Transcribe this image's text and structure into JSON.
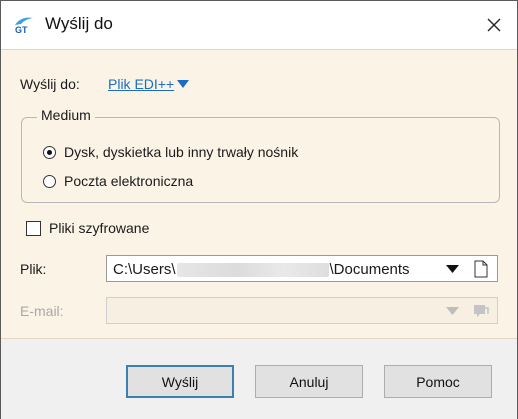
{
  "window": {
    "title": "Wyślij do",
    "app_icon": "gt-logo-icon",
    "close_icon": "close-icon"
  },
  "send_to": {
    "label": "Wyślij do:",
    "value": "Plik EDI++",
    "dropdown_icon": "caret-down-icon"
  },
  "medium": {
    "legend": "Medium",
    "options": [
      {
        "label": "Dysk, dyskietka lub inny trwały nośnik",
        "checked": true
      },
      {
        "label": "Poczta elektroniczna",
        "checked": false
      }
    ]
  },
  "encrypted": {
    "label": "Pliki szyfrowane",
    "checked": false
  },
  "file": {
    "label": "Plik:",
    "path_prefix": "C:\\Users\\",
    "path_suffix": "\\Documents"
  },
  "email": {
    "label": "E-mail:",
    "value": "",
    "disabled": true
  },
  "buttons": {
    "send": "Wyślij",
    "cancel": "Anuluj",
    "help": "Pomoc"
  },
  "colors": {
    "link": "#1a6dc2",
    "dialog_bg": "#fbf4e6",
    "default_button_border": "#3c7fb1"
  }
}
